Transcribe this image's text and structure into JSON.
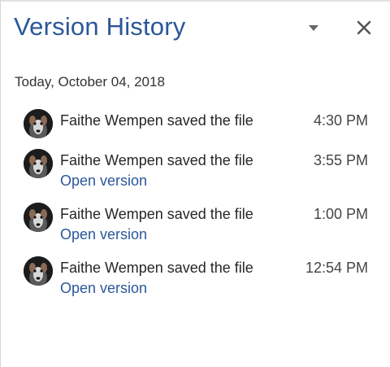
{
  "pane": {
    "title": "Version History",
    "dropdown_icon": "dropdown-arrow-icon",
    "close_icon": "close-icon"
  },
  "date_heading": "Today, October 04, 2018",
  "entries": [
    {
      "text": "Faithe Wempen saved the file",
      "time": "4:30 PM",
      "link": ""
    },
    {
      "text": "Faithe Wempen saved the file",
      "time": "3:55 PM",
      "link": "Open version"
    },
    {
      "text": "Faithe Wempen saved the file",
      "time": "1:00 PM",
      "link": "Open version"
    },
    {
      "text": "Faithe Wempen saved the file",
      "time": "12:54 PM",
      "link": "Open version"
    }
  ],
  "colors": {
    "accent": "#2b579a",
    "text": "#262626",
    "time": "#444444"
  }
}
